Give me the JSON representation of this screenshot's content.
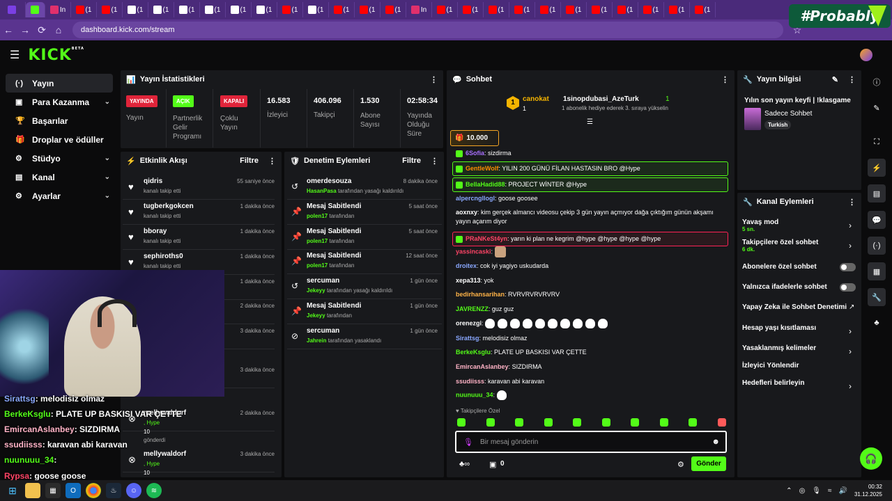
{
  "browser": {
    "tabs": [
      "",
      "",
      "In",
      "(1",
      "(1",
      "(1",
      "(1",
      "(1",
      "(1",
      "(1",
      "(1",
      "(1",
      "(1",
      "(1",
      "(1",
      "(1",
      "In",
      "(1",
      "(1",
      "(1",
      "(1",
      "(1",
      "(1",
      "(1",
      "(1",
      "(1",
      "(1",
      "(1"
    ],
    "url": "dashboard.kick.com/stream",
    "watermark": "#Probably"
  },
  "nav": {
    "logo": "KICK",
    "beta": "BETA"
  },
  "sidebar": {
    "items": [
      {
        "label": "Yayın",
        "icon": "(·)"
      },
      {
        "label": "Para Kazanma",
        "icon": "▣"
      },
      {
        "label": "Başarılar",
        "icon": "🏆"
      },
      {
        "label": "Droplar ve ödüller",
        "icon": "🎁"
      },
      {
        "label": "Stüdyo",
        "icon": "⚙"
      },
      {
        "label": "Kanal",
        "icon": "▤"
      },
      {
        "label": "Ayarlar",
        "icon": "⚙"
      }
    ]
  },
  "stats": {
    "title": "Yayın İstatistikleri",
    "badges": [
      {
        "badge": "YAYINDA",
        "label": "Yayın",
        "color": "#e0243a"
      },
      {
        "badge": "AÇIK",
        "label": "Partnerlik Gelir Programı",
        "color": "#53fc18"
      },
      {
        "badge": "KAPALI",
        "label": "Çoklu Yayın",
        "color": "#e0243a"
      }
    ],
    "values": [
      {
        "value": "16.583",
        "label": "İzleyici"
      },
      {
        "value": "406.096",
        "label": "Takipçi"
      },
      {
        "value": "1.530",
        "label": "Abone Sayısı"
      },
      {
        "value": "02:58:34",
        "label": "Yayında Olduğu Süre"
      }
    ]
  },
  "activity": {
    "title": "Etkinlik Akışı",
    "filter": "Filtre",
    "rows": [
      {
        "name": "qidris",
        "sub": "kanalı takip etti",
        "time": "55 saniye önce"
      },
      {
        "name": "tugberkgokcen",
        "sub": "kanalı takip etti",
        "time": "1 dakika önce"
      },
      {
        "name": "bboray",
        "sub": "kanalı takip etti",
        "time": "1 dakika önce"
      },
      {
        "name": "sephiroths0",
        "sub": "kanalı takip etti",
        "time": "1 dakika önce"
      },
      {
        "name": "",
        "sub": "",
        "time": "1 dakika önce"
      },
      {
        "name": "",
        "sub": "",
        "time": "2 dakika önce"
      },
      {
        "name": "",
        "sub": "",
        "time": "3 dakika önce"
      },
      {
        "name": "",
        "sub": "gönderdi",
        "time": "3 dakika önce"
      },
      {
        "name": "mellywaldorf",
        "sub": ", Hype",
        "extra": "10",
        "extra2": "gönderdi",
        "time": "2 dakika önce"
      },
      {
        "name": "mellywaldorf",
        "sub": ", Hype",
        "extra": "10",
        "time": "3 dakika önce"
      }
    ]
  },
  "moderation": {
    "title": "Denetim Eylemleri",
    "filter": "Filtre",
    "rows": [
      {
        "name": "omerdesouza",
        "who": "HasanPasa",
        "action": "tarafından yasağı kaldırıldı",
        "time": "8 dakika önce"
      },
      {
        "name": "Mesaj Sabitlendi",
        "who": "polen17",
        "action": "tarafından",
        "time": "5 saat önce"
      },
      {
        "name": "Mesaj Sabitlendi",
        "who": "polen17",
        "action": "tarafından",
        "time": "5 saat önce"
      },
      {
        "name": "Mesaj Sabitlendi",
        "who": "polen17",
        "action": "tarafından",
        "time": "12 saat önce"
      },
      {
        "name": "sercuman",
        "who": "Jekeyy",
        "action": "tarafından yasağı kaldırıldı",
        "time": "1 gün önce"
      },
      {
        "name": "Mesaj Sabitlendi",
        "who": "Jekeyy",
        "action": "tarafından",
        "time": "1 gün önce"
      },
      {
        "name": "sercuman",
        "who": "Jahrein",
        "action": "tarafından yasaklandı",
        "time": "1 gün önce"
      }
    ]
  },
  "chat": {
    "title": "Sohbet",
    "pinned_user": "canokat",
    "pinned_count": "1",
    "gift_user": "1sinopdubasi_AzeTurk",
    "gift_text": "1 abonelik hediye ederek 3. sıraya yükselin",
    "gift_count": "1",
    "goal": "10.000",
    "messages": [
      {
        "user": "6Sofia",
        "color": "#a970ff",
        "text": "sizdirma"
      },
      {
        "user": "GentleWolf",
        "color": "#ff8c00",
        "text": "YILIN 200 GÜNÜ FİLAN HASTASIN BRO @Hype",
        "hl": "green"
      },
      {
        "user": "BellaHadid88",
        "color": "#53fc18",
        "text": "PROJECT WİNTER @Hype",
        "hl": "green"
      },
      {
        "user": "alpercngllogl",
        "color": "#8aa8ff",
        "text": "goose goosee"
      },
      {
        "user": "aoxnxy",
        "color": "#ffffff",
        "text": "kim gerçek almancı videosu çekip 3 gün yayın açmıyor dağa çıktığım günün akşamı yayın açarım diyor"
      },
      {
        "user": "PRaNKeSt4yn",
        "color": "#ff4466",
        "text": "yarın ki plan ne kegrim @hype @hype @hype @hype",
        "hl": "red"
      },
      {
        "user": "yassincaski",
        "color": "#ff4466",
        "text": ""
      },
      {
        "user": "droitex",
        "color": "#8aa8ff",
        "text": "cok iyi yagiyo uskudarda"
      },
      {
        "user": "xepa313",
        "color": "#ffffff",
        "text": "yok"
      },
      {
        "user": "bedirhansarihan",
        "color": "#ffb347",
        "text": "RVRVRVRVRVRV"
      },
      {
        "user": "JAVRENZZ",
        "color": "#53fc18",
        "text": "guz guz"
      },
      {
        "user": "orenezgi",
        "color": "#ffffff",
        "text": ""
      },
      {
        "user": "Sirattsg",
        "color": "#8aa8ff",
        "text": "melodisiz olmaz"
      },
      {
        "user": "BerkeKsglu",
        "color": "#53fc18",
        "text": "PLATE UP BASKISI VAR ÇETTE"
      },
      {
        "user": "EmircanAslanbey",
        "color": "#ffb3c6",
        "text": "SIZDIRMA"
      },
      {
        "user": "ssudiisss",
        "color": "#ffb3c6",
        "text": "karavan abi karavan"
      },
      {
        "user": "nuunuuu_34",
        "color": "#53fc18",
        "text": ""
      }
    ],
    "followers_only": "Takipçilere Özel",
    "placeholder": "Bir mesaj gönderin",
    "send": "Gönder",
    "gift_count_bottom": "0"
  },
  "stream_info": {
    "title": "Yayın bilgisi",
    "stream_title": "Yılın son yayın keyfi | !klasgame",
    "category": "Sadece Sohbet",
    "tag": "Turkish"
  },
  "channel_actions": {
    "title": "Kanal Eylemleri",
    "items": [
      {
        "label": "Yavaş mod",
        "sub": "5 sn.",
        "type": "chev"
      },
      {
        "label": "Takipçilere özel sohbet",
        "sub": "6 dk.",
        "type": "chev"
      },
      {
        "label": "Abonelere özel sohbet",
        "sub": "",
        "type": "toggle"
      },
      {
        "label": "Yalnızca ifadelerle sohbet",
        "sub": "",
        "type": "toggle"
      },
      {
        "label": "Yapay Zeka ile Sohbet Denetimi",
        "sub": "",
        "type": "ext"
      },
      {
        "label": "Hesap yaşı kısıtlaması",
        "sub": "",
        "type": "chev"
      },
      {
        "label": "Yasaklanmış kelimeler",
        "sub": "",
        "type": "chev"
      },
      {
        "label": "İzleyici Yönlendir",
        "sub": "",
        "type": "none"
      },
      {
        "label": "Hedefleri belirleyin",
        "sub": "",
        "type": "chev"
      }
    ]
  },
  "overlay_chat": [
    {
      "user": "Sirattsg",
      "text": ": melodisiz olmaz",
      "color": "#8aa8ff"
    },
    {
      "user": "BerkeKsglu",
      "text": ": PLATE UP BASKISI VAR ÇETTE",
      "color": "#53fc18"
    },
    {
      "user": "EmircanAslanbey",
      "text": ": SIZDIRMA",
      "color": "#ffb3c6"
    },
    {
      "user": "ssudiisss",
      "text": ": karavan abi karavan",
      "color": "#ffb3c6"
    },
    {
      "user": "nuunuuu_34",
      "text": ":",
      "color": "#53fc18"
    },
    {
      "user": "Rypsa",
      "text": ": goose goose",
      "color": "#ff4466"
    }
  ],
  "taskbar": {
    "time": "00:32",
    "date": "31.12.2025"
  }
}
